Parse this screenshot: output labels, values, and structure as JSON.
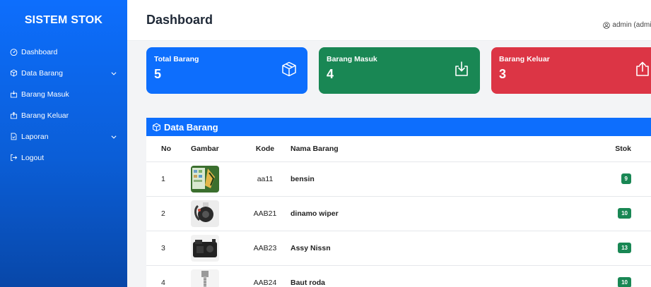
{
  "sidebar": {
    "brand": "SISTEM STOK",
    "items": [
      {
        "label": "Dashboard",
        "icon": "speedometer-icon"
      },
      {
        "label": "Data Barang",
        "icon": "box-icon",
        "has_submenu": true
      },
      {
        "label": "Barang Masuk",
        "icon": "box-in-icon"
      },
      {
        "label": "Barang Keluar",
        "icon": "box-out-icon"
      },
      {
        "label": "Laporan",
        "icon": "file-icon",
        "has_submenu": true
      },
      {
        "label": "Logout",
        "icon": "logout-icon"
      }
    ]
  },
  "header": {
    "title": "Dashboard",
    "user": "admin (admin"
  },
  "cards": [
    {
      "label": "Total Barang",
      "value": "5",
      "color": "#0d6efd",
      "icon": "box-icon"
    },
    {
      "label": "Barang Masuk",
      "value": "4",
      "color": "#198754",
      "icon": "download-box-icon"
    },
    {
      "label": "Barang Keluar",
      "value": "3",
      "color": "#dc3545",
      "icon": "upload-box-icon"
    }
  ],
  "table": {
    "title": "Data Barang",
    "columns": [
      "No",
      "Gambar",
      "Kode",
      "Nama Barang",
      "Stok"
    ],
    "rows": [
      {
        "no": "1",
        "kode": "aa11",
        "nama": "bensin",
        "stok": "9"
      },
      {
        "no": "2",
        "kode": "AAB21",
        "nama": "dinamo wiper",
        "stok": "10"
      },
      {
        "no": "3",
        "kode": "AAB23",
        "nama": "Assy Nissn",
        "stok": "13"
      },
      {
        "no": "4",
        "kode": "AAB24",
        "nama": "Baut roda",
        "stok": "10"
      }
    ]
  },
  "colors": {
    "primary": "#0d6efd",
    "success": "#198754",
    "danger": "#dc3545"
  }
}
